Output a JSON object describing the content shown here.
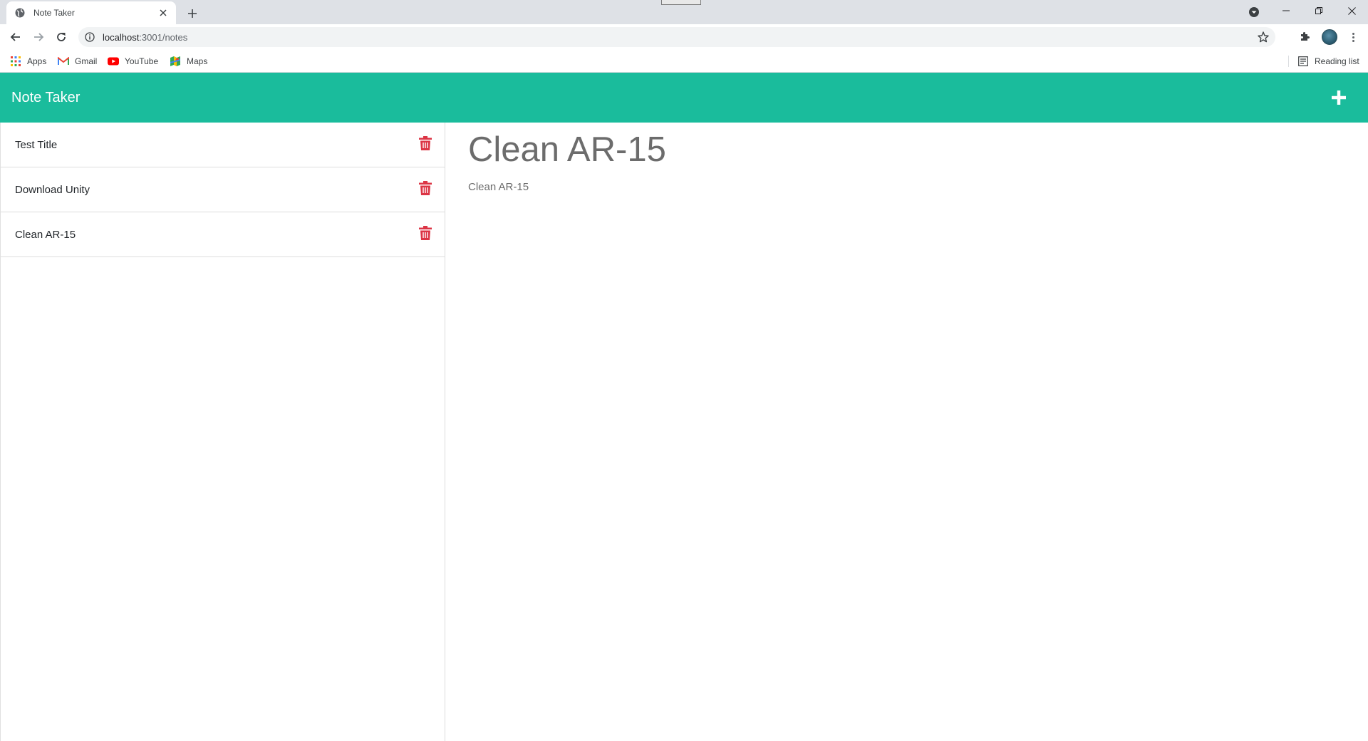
{
  "browser": {
    "tab_title": "Note Taker",
    "url_host": "localhost",
    "url_path": ":3001/notes",
    "bookmarks": [
      {
        "label": "Apps"
      },
      {
        "label": "Gmail"
      },
      {
        "label": "YouTube"
      },
      {
        "label": "Maps"
      }
    ],
    "reading_list": "Reading list"
  },
  "app": {
    "brand": "Note Taker",
    "accent_color": "#1abc9c",
    "delete_color": "#dc3545",
    "notes": [
      {
        "title": "Test Title"
      },
      {
        "title": "Download Unity"
      },
      {
        "title": "Clean AR-15"
      }
    ],
    "active_note": {
      "title": "Clean AR-15",
      "text": "Clean AR-15"
    }
  }
}
